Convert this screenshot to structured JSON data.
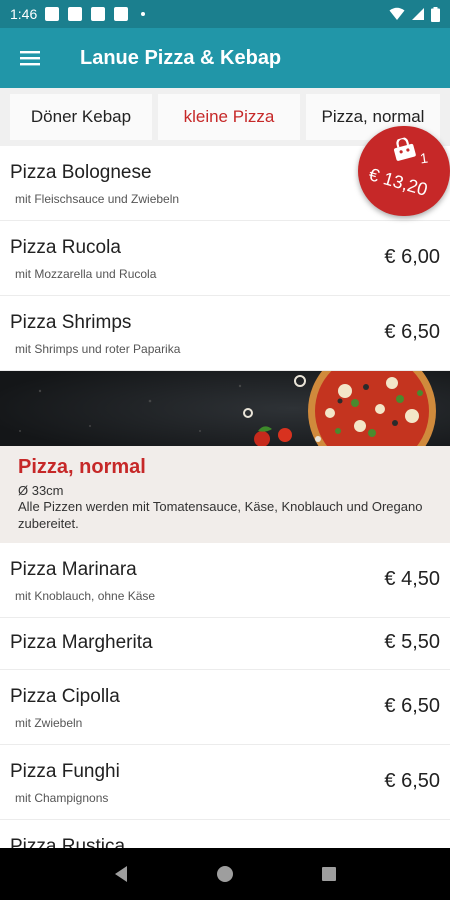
{
  "status": {
    "time": "1:46"
  },
  "app": {
    "title": "Lanue Pizza & Kebap"
  },
  "tabs": [
    {
      "label": "Döner Kebap"
    },
    {
      "label": "kleine Pizza"
    },
    {
      "label": "Pizza, normal"
    }
  ],
  "small_pizzas": [
    {
      "name": "Pizza Bolognese",
      "desc": "mit Fleischsauce und Zwiebeln"
    },
    {
      "name": "Pizza Rucola",
      "desc": "mit Mozzarella und Rucola",
      "price": "€ 6,00"
    },
    {
      "name": "Pizza Shrimps",
      "desc": "mit Shrimps und roter Paparika",
      "price": "€ 6,50"
    }
  ],
  "section": {
    "title": "Pizza, normal",
    "size": "Ø 33cm",
    "note": "Alle Pizzen werden mit Tomatensauce, Käse, Knoblauch und Oregano zubereitet."
  },
  "normal_pizzas": [
    {
      "name": "Pizza Marinara",
      "desc": "mit Knoblauch, ohne Käse",
      "price": "€ 4,50"
    },
    {
      "name": "Pizza Margherita",
      "price": "€ 5,50"
    },
    {
      "name": "Pizza Cipolla",
      "desc": "mit Zwiebeln",
      "price": "€ 6,50"
    },
    {
      "name": "Pizza Funghi",
      "desc": "mit Champignons",
      "price": "€ 6,50"
    },
    {
      "name": "Pizza Rustica"
    }
  ],
  "cart": {
    "count": "1",
    "total": "€ 13,20"
  },
  "colors": {
    "primary": "#2196a8",
    "status": "#1b7f8e",
    "accent": "#c62828"
  }
}
